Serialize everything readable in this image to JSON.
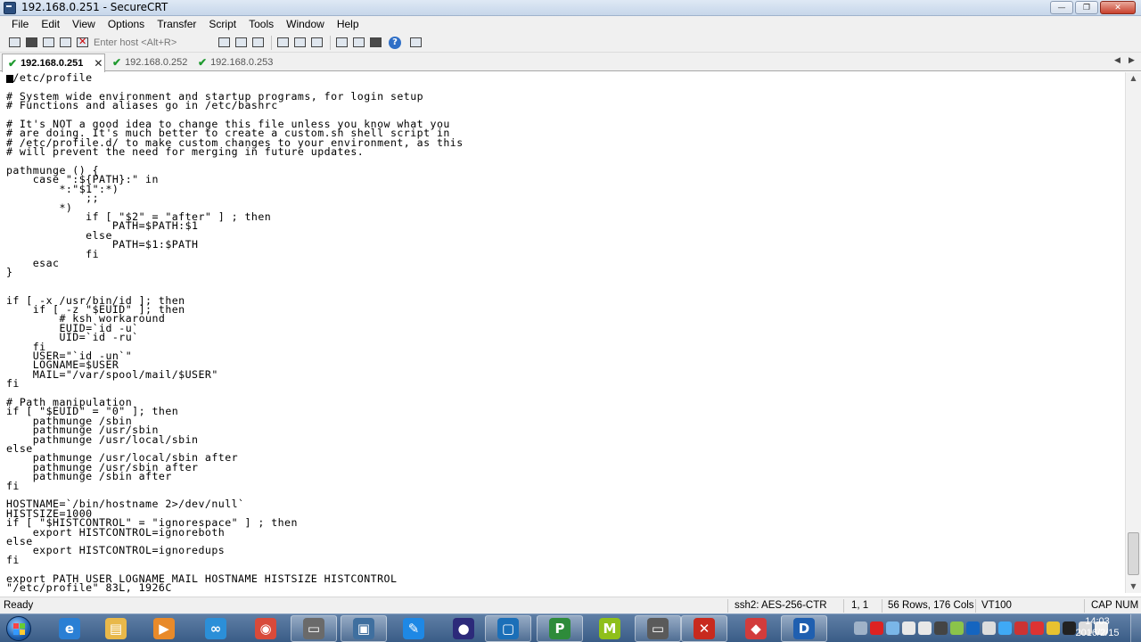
{
  "window": {
    "title": "192.168.0.251 - SecureCRT",
    "buttons": {
      "minimize": "—",
      "maximize": "❐",
      "close": "✕"
    }
  },
  "menu": [
    "File",
    "Edit",
    "View",
    "Options",
    "Transfer",
    "Script",
    "Tools",
    "Window",
    "Help"
  ],
  "toolbar": {
    "host_placeholder": "Enter host <Alt+R>",
    "help_glyph": "?"
  },
  "tabs": [
    {
      "label": "192.168.0.251",
      "active": true,
      "connected": true
    },
    {
      "label": "192.168.0.252",
      "active": false,
      "connected": true
    },
    {
      "label": "192.168.0.253",
      "active": false,
      "connected": true
    }
  ],
  "tab_glyphs": {
    "check": "✔",
    "close": "✕",
    "prev": "◀",
    "next": "▶"
  },
  "terminal": {
    "lines": [
      " /etc/profile",
      "",
      "# System wide environment and startup programs, for login setup",
      "# Functions and aliases go in /etc/bashrc",
      "",
      "# It's NOT a good idea to change this file unless you know what you",
      "# are doing. It's much better to create a custom.sh shell script in",
      "# /etc/profile.d/ to make custom changes to your environment, as this",
      "# will prevent the need for merging in future updates.",
      "",
      "pathmunge () {",
      "    case \":${PATH}:\" in",
      "        *:\"$1\":*)",
      "            ;;",
      "        *)",
      "            if [ \"$2\" = \"after\" ] ; then",
      "                PATH=$PATH:$1",
      "            else",
      "                PATH=$1:$PATH",
      "            fi",
      "    esac",
      "}",
      "",
      "",
      "if [ -x /usr/bin/id ]; then",
      "    if [ -z \"$EUID\" ]; then",
      "        # ksh workaround",
      "        EUID=`id -u`",
      "        UID=`id -ru`",
      "    fi",
      "    USER=\"`id -un`\"",
      "    LOGNAME=$USER",
      "    MAIL=\"/var/spool/mail/$USER\"",
      "fi",
      "",
      "# Path manipulation",
      "if [ \"$EUID\" = \"0\" ]; then",
      "    pathmunge /sbin",
      "    pathmunge /usr/sbin",
      "    pathmunge /usr/local/sbin",
      "else",
      "    pathmunge /usr/local/sbin after",
      "    pathmunge /usr/sbin after",
      "    pathmunge /sbin after",
      "fi",
      "",
      "HOSTNAME=`/bin/hostname 2>/dev/null`",
      "HISTSIZE=1000",
      "if [ \"$HISTCONTROL\" = \"ignorespace\" ] ; then",
      "    export HISTCONTROL=ignoreboth",
      "else",
      "    export HISTCONTROL=ignoredups",
      "fi",
      "",
      "export PATH USER LOGNAME MAIL HOSTNAME HISTSIZE HISTCONTROL",
      "\"/etc/profile\" 83L, 1926C"
    ]
  },
  "statusbar": {
    "ready": "Ready",
    "cipher": "ssh2: AES-256-CTR",
    "position": "1,   1",
    "size": "56 Rows, 176 Cols",
    "emulation": "VT100",
    "caps": "CAP",
    "num": "NUM"
  },
  "taskbar": {
    "apps": [
      {
        "icon": "internet-explorer-icon",
        "color": "#2a7fd4",
        "glyph": "e",
        "running": false
      },
      {
        "icon": "file-explorer-icon",
        "color": "#e8b84a",
        "glyph": "▤",
        "running": false
      },
      {
        "icon": "media-player-icon",
        "color": "#e88a2a",
        "glyph": "▶",
        "running": false
      },
      {
        "icon": "network-app-icon",
        "color": "#2b8fd8",
        "glyph": "∞",
        "running": false
      },
      {
        "icon": "chrome-icon",
        "color": "#d84a3a",
        "glyph": "◉",
        "running": false
      },
      {
        "icon": "securecrt-icon",
        "color": "#6a6a6a",
        "glyph": "▭",
        "running": true
      },
      {
        "icon": "remote-desktop-icon",
        "color": "#3f6f9f",
        "glyph": "▣",
        "running": true
      },
      {
        "icon": "pen-app-icon",
        "color": "#1e88e5",
        "glyph": "✎",
        "running": false
      },
      {
        "icon": "eclipse-icon",
        "color": "#2c2a7a",
        "glyph": "●",
        "running": false
      },
      {
        "icon": "virtualbox-icon",
        "color": "#1b6fb8",
        "glyph": "▢",
        "running": true
      },
      {
        "icon": "publisher-app-icon",
        "color": "#2e8b3a",
        "glyph": "P",
        "running": true
      },
      {
        "icon": "mindmap-app-icon",
        "color": "#8fbf1a",
        "glyph": "M",
        "running": false
      },
      {
        "icon": "securefx-icon",
        "color": "#5a5a5a",
        "glyph": "▭",
        "running": true
      },
      {
        "icon": "pdf-app-icon",
        "color": "#c82a1e",
        "glyph": "✕",
        "running": true
      },
      {
        "icon": "redbook-app-icon",
        "color": "#d23c3c",
        "glyph": "◆",
        "running": false
      },
      {
        "icon": "dubbo-app-icon",
        "color": "#1f5fb0",
        "glyph": "D",
        "running": true
      }
    ],
    "tray_colors": [
      "#9fb2c8",
      "#d22",
      "#7ab6e8",
      "#e8e8e8",
      "#e8e8e8",
      "#444",
      "#8bc34a",
      "#1565c0",
      "#ddd",
      "#3fa9f5",
      "#c33",
      "#d33",
      "#e8c230",
      "#222",
      "#ddd",
      "#eee"
    ],
    "clock_time": "14:03",
    "clock_date": "2016/2/15"
  },
  "colors": {
    "terminal_bg": "#ffffff",
    "terminal_fg": "#000000",
    "connected_check": "#1f9a2f"
  }
}
